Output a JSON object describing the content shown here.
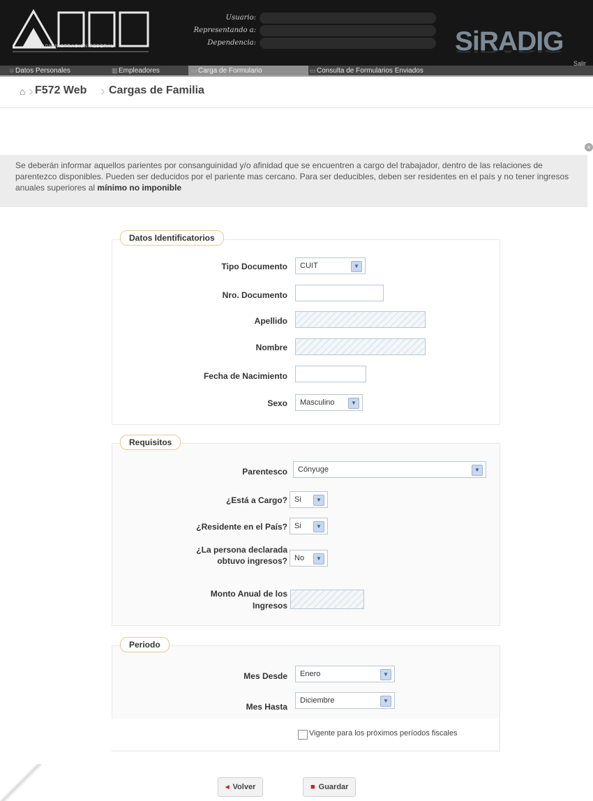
{
  "header": {
    "logo_sub": "ADMINISTRACION FEDERAL",
    "usuario_label": "Usuario:",
    "representando_label": "Representando a:",
    "dependencia_label": "Dependencia:",
    "brand": "SiRADIG",
    "salir": "Salir"
  },
  "nav": {
    "items": [
      {
        "label": "Datos Personales",
        "icon": "user-icon"
      },
      {
        "label": "Empleadores",
        "icon": "building-icon"
      },
      {
        "label": "Carga de Formulario",
        "icon": "form-icon"
      },
      {
        "label": "Consulta de Formularios Enviados",
        "icon": "list-icon"
      }
    ],
    "active_index": 2
  },
  "breadcrumb": {
    "items": [
      "F572 Web",
      "Cargas de Familia"
    ]
  },
  "info_text_1": "Se deberán informar aquellos parientes por consanguinidad y/o afinidad que se encuentren a cargo del trabajador, dentro de las relaciones de parentezco disponibles. Pueden ser deducidos por el pariente mas cercano. Para ser deducibles, deben ser residentes en el país y no tener ingresos anuales superiores al",
  "info_text_bold": "mínimo no imponible",
  "datos": {
    "legend": "Datos Identificatorios",
    "tipo_doc_label": "Tipo Documento",
    "tipo_doc_value": "CUIT",
    "nro_doc_label": "Nro. Documento",
    "apellido_label": "Apellido",
    "nombre_label": "Nombre",
    "fecha_label": "Fecha de Nacimiento",
    "sexo_label": "Sexo",
    "sexo_value": "Masculino"
  },
  "requisitos": {
    "legend": "Requisitos",
    "parentesco_label": "Parentesco",
    "parentesco_value": "Cónyuge",
    "a_cargo_label": "¿Está a Cargo?",
    "a_cargo_value": "Si",
    "residente_label": "¿Residente en el País?",
    "residente_value": "Si",
    "ingresos_label_1": "¿La persona declarada",
    "ingresos_label_2": "obtuvo ingresos?",
    "ingresos_value": "No",
    "monto_label_1": "Monto Anual de los",
    "monto_label_2": "Ingresos"
  },
  "periodo": {
    "legend": "Periodo",
    "desde_label": "Mes Desde",
    "desde_value": "Enero",
    "hasta_label": "Mes Hasta",
    "hasta_value": "Diciembre",
    "vigente_label": "Vigente para los próximos períodos fiscales"
  },
  "buttons": {
    "volver": "Volver",
    "guardar": "Guardar"
  }
}
